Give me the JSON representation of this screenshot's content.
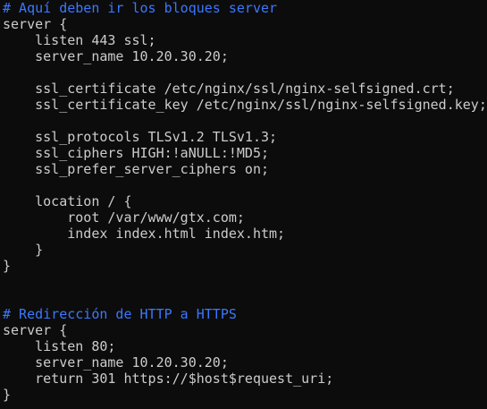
{
  "terminal": {
    "lines": [
      {
        "type": "comment",
        "text": "# Aquí deben ir los bloques server"
      },
      {
        "type": "text",
        "text": "server {"
      },
      {
        "type": "text",
        "text": "    listen 443 ssl;"
      },
      {
        "type": "text",
        "text": "    server_name 10.20.30.20;"
      },
      {
        "type": "text",
        "text": ""
      },
      {
        "type": "text",
        "text": "    ssl_certificate /etc/nginx/ssl/nginx-selfsigned.crt;"
      },
      {
        "type": "text",
        "text": "    ssl_certificate_key /etc/nginx/ssl/nginx-selfsigned.key;"
      },
      {
        "type": "text",
        "text": ""
      },
      {
        "type": "text",
        "text": "    ssl_protocols TLSv1.2 TLSv1.3;"
      },
      {
        "type": "text",
        "text": "    ssl_ciphers HIGH:!aNULL:!MD5;"
      },
      {
        "type": "text",
        "text": "    ssl_prefer_server_ciphers on;"
      },
      {
        "type": "text",
        "text": ""
      },
      {
        "type": "text",
        "text": "    location / {"
      },
      {
        "type": "text",
        "text": "        root /var/www/gtx.com;"
      },
      {
        "type": "text",
        "text": "        index index.html index.htm;"
      },
      {
        "type": "text",
        "text": "    }"
      },
      {
        "type": "text",
        "text": "}"
      },
      {
        "type": "text",
        "text": ""
      },
      {
        "type": "text",
        "text": ""
      },
      {
        "type": "comment",
        "text": "# Redirección de HTTP a HTTPS"
      },
      {
        "type": "text",
        "text": "server {"
      },
      {
        "type": "text",
        "text": "    listen 80;"
      },
      {
        "type": "text",
        "text": "    server_name 10.20.30.20;"
      },
      {
        "type": "text",
        "text": "    return 301 https://$host$request_uri;"
      },
      {
        "type": "text",
        "text": "}"
      }
    ]
  },
  "colors": {
    "background": "#0c0c0c",
    "foreground": "#cccccc",
    "comment": "#3b78ff"
  }
}
